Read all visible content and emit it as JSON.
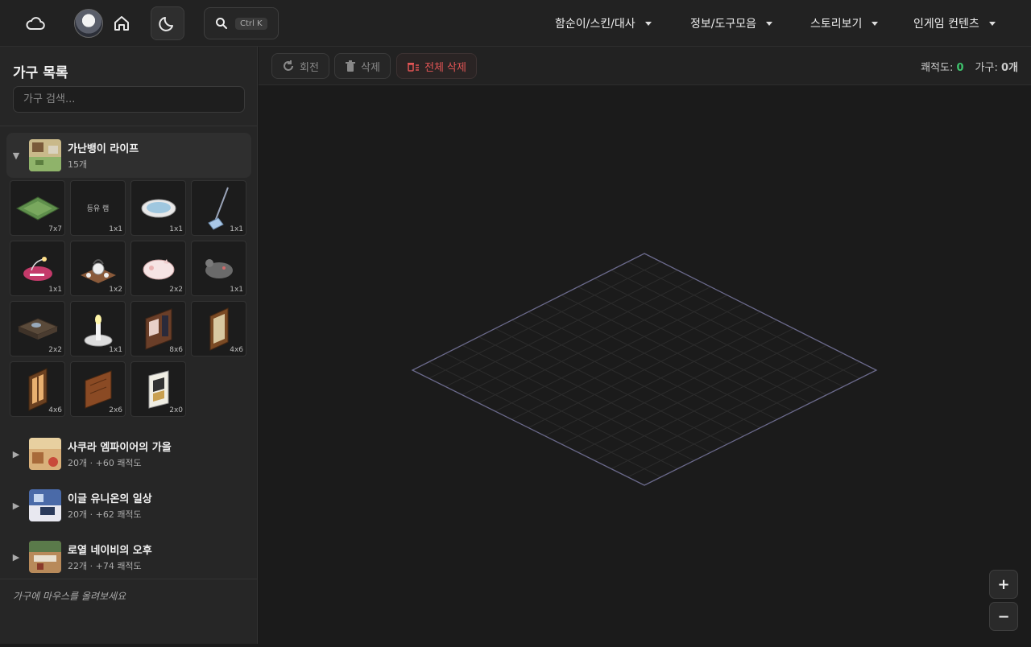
{
  "header": {
    "search_shortcut": "Ctrl K",
    "nav": [
      {
        "label": "함순이/스킨/대사"
      },
      {
        "label": "정보/도구모음"
      },
      {
        "label": "스토리보기"
      },
      {
        "label": "인게임 컨텐츠"
      }
    ]
  },
  "sidebar": {
    "title": "가구 목록",
    "search_placeholder": "가구 검색...",
    "sets": [
      {
        "name": "가난뱅이 라이프",
        "sub": "15개",
        "expanded": true
      },
      {
        "name": "사쿠라 엠파이어의 가을",
        "sub": "20개 · +60 쾌적도",
        "expanded": false
      },
      {
        "name": "이글 유니온의 일상",
        "sub": "20개 · +62 쾌적도",
        "expanded": false
      },
      {
        "name": "로열 네이비의 오후",
        "sub": "22개 · +74 쾌적도",
        "expanded": false
      }
    ],
    "items": [
      {
        "size": "7x7",
        "icon": "green-mat-icon"
      },
      {
        "size": "1x1",
        "text": "등유 램",
        "icon": ""
      },
      {
        "size": "1x1",
        "icon": "washbasin-icon"
      },
      {
        "size": "1x1",
        "icon": "mop-icon"
      },
      {
        "size": "1x1",
        "icon": "anglerfish-lamp-icon"
      },
      {
        "size": "1x2",
        "icon": "tea-set-icon"
      },
      {
        "size": "2x2",
        "icon": "pig-cushion-icon"
      },
      {
        "size": "1x1",
        "icon": "mouse-plush-icon"
      },
      {
        "size": "2x2",
        "icon": "low-table-icon"
      },
      {
        "size": "1x1",
        "icon": "candle-icon"
      },
      {
        "size": "8x6",
        "icon": "wall-shelf-icon"
      },
      {
        "size": "4x6",
        "icon": "wall-frame-icon"
      },
      {
        "size": "4x6",
        "icon": "window-icon"
      },
      {
        "size": "2x6",
        "icon": "wooden-panel-icon"
      },
      {
        "size": "2x0",
        "icon": "poster-icon"
      }
    ],
    "hint": "가구에 마우스를 올려보세요"
  },
  "toolbar": {
    "rotate_label": "회전",
    "delete_label": "삭제",
    "delete_all_label": "전체 삭제"
  },
  "stats": {
    "comfort_label": "쾌적도:",
    "comfort_value": "0",
    "furniture_label": "가구:",
    "furniture_value": "0개"
  },
  "zoom": {
    "in": "+",
    "out": "−"
  },
  "colors": {
    "accent_green": "#3ec46d",
    "danger_red": "#e25555",
    "grid_line": "#6b6a8c"
  }
}
